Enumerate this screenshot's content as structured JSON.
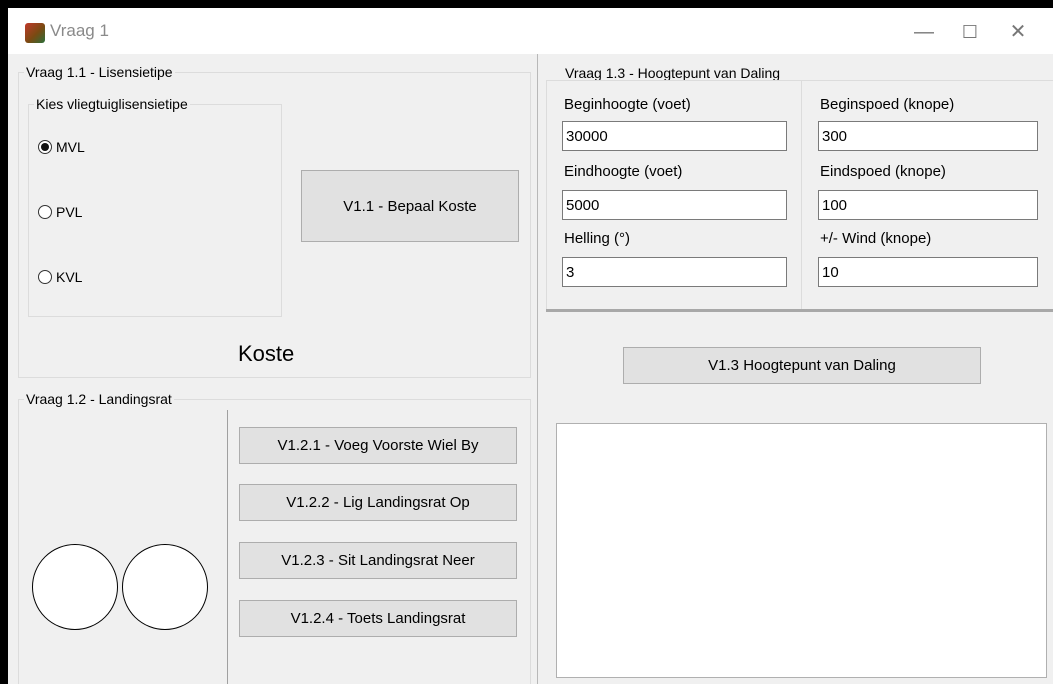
{
  "window": {
    "title": "Vraag 1",
    "minimize_glyph": "—",
    "maximize_glyph": "☐",
    "close_glyph": "✕"
  },
  "q1_1": {
    "group_title": "Vraag 1.1 - Lisensietipe",
    "license_group_title": "Kies vliegtuiglisensietipe",
    "options": [
      {
        "label": "MVL",
        "checked": true
      },
      {
        "label": "PVL",
        "checked": false
      },
      {
        "label": "KVL",
        "checked": false
      }
    ],
    "cost_button": "V1.1 - Bepaal Koste",
    "cost_label": "Koste"
  },
  "q1_2": {
    "group_title": "Vraag 1.2 - Landingsrat",
    "buttons": [
      "V1.2.1 - Voeg Voorste Wiel By",
      "V1.2.2 - Lig Landingsrat Op",
      "V1.2.3 - Sit Landingsrat Neer",
      "V1.2.4 - Toets Landingsrat"
    ]
  },
  "q1_3": {
    "group_title": "Vraag 1.3 - Hoogtepunt van Daling",
    "start_height_label": "Beginhoogte (voet)",
    "start_height_value": "30000",
    "start_speed_label": "Beginspoed (knope)",
    "start_speed_value": "300",
    "end_height_label": "Eindhoogte (voet)",
    "end_height_value": "5000",
    "end_speed_label": "Eindspoed (knope)",
    "end_speed_value": "100",
    "slope_label": "Helling (°)",
    "slope_value": "3",
    "wind_label": "+/- Wind (knope)",
    "wind_value": "10",
    "calc_button": "V1.3  Hoogtepunt van Daling",
    "output_text": ""
  }
}
